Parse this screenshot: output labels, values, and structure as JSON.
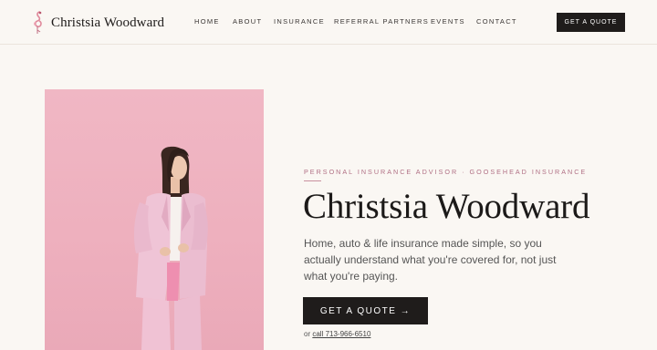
{
  "brand": {
    "name": "Christsia Woodward",
    "logo_icon": "flamingo-logo-icon"
  },
  "nav": {
    "items": [
      {
        "label": "HOME"
      },
      {
        "label": "ABOUT"
      },
      {
        "label": "INSURANCE"
      },
      {
        "label": "REFERRAL PARTNERS"
      },
      {
        "label": "EVENTS"
      },
      {
        "label": "CONTACT"
      }
    ],
    "cta_label": "GET A QUOTE"
  },
  "hero": {
    "eyebrow": "PERSONAL INSURANCE ADVISOR · GOOSEHEAD INSURANCE",
    "headline": "Christsia Woodward",
    "subtext": "Home, auto & life insurance made simple, so you actually understand what you're covered for, not just what you're paying.",
    "cta_label": "GET A QUOTE →",
    "call_prefix": "or ",
    "call_link": "call 713-966-6510"
  },
  "colors": {
    "background": "#faf7f3",
    "dark": "#1f1c1b",
    "accent": "#b06f84",
    "photo_pink": "#eeb0be"
  }
}
